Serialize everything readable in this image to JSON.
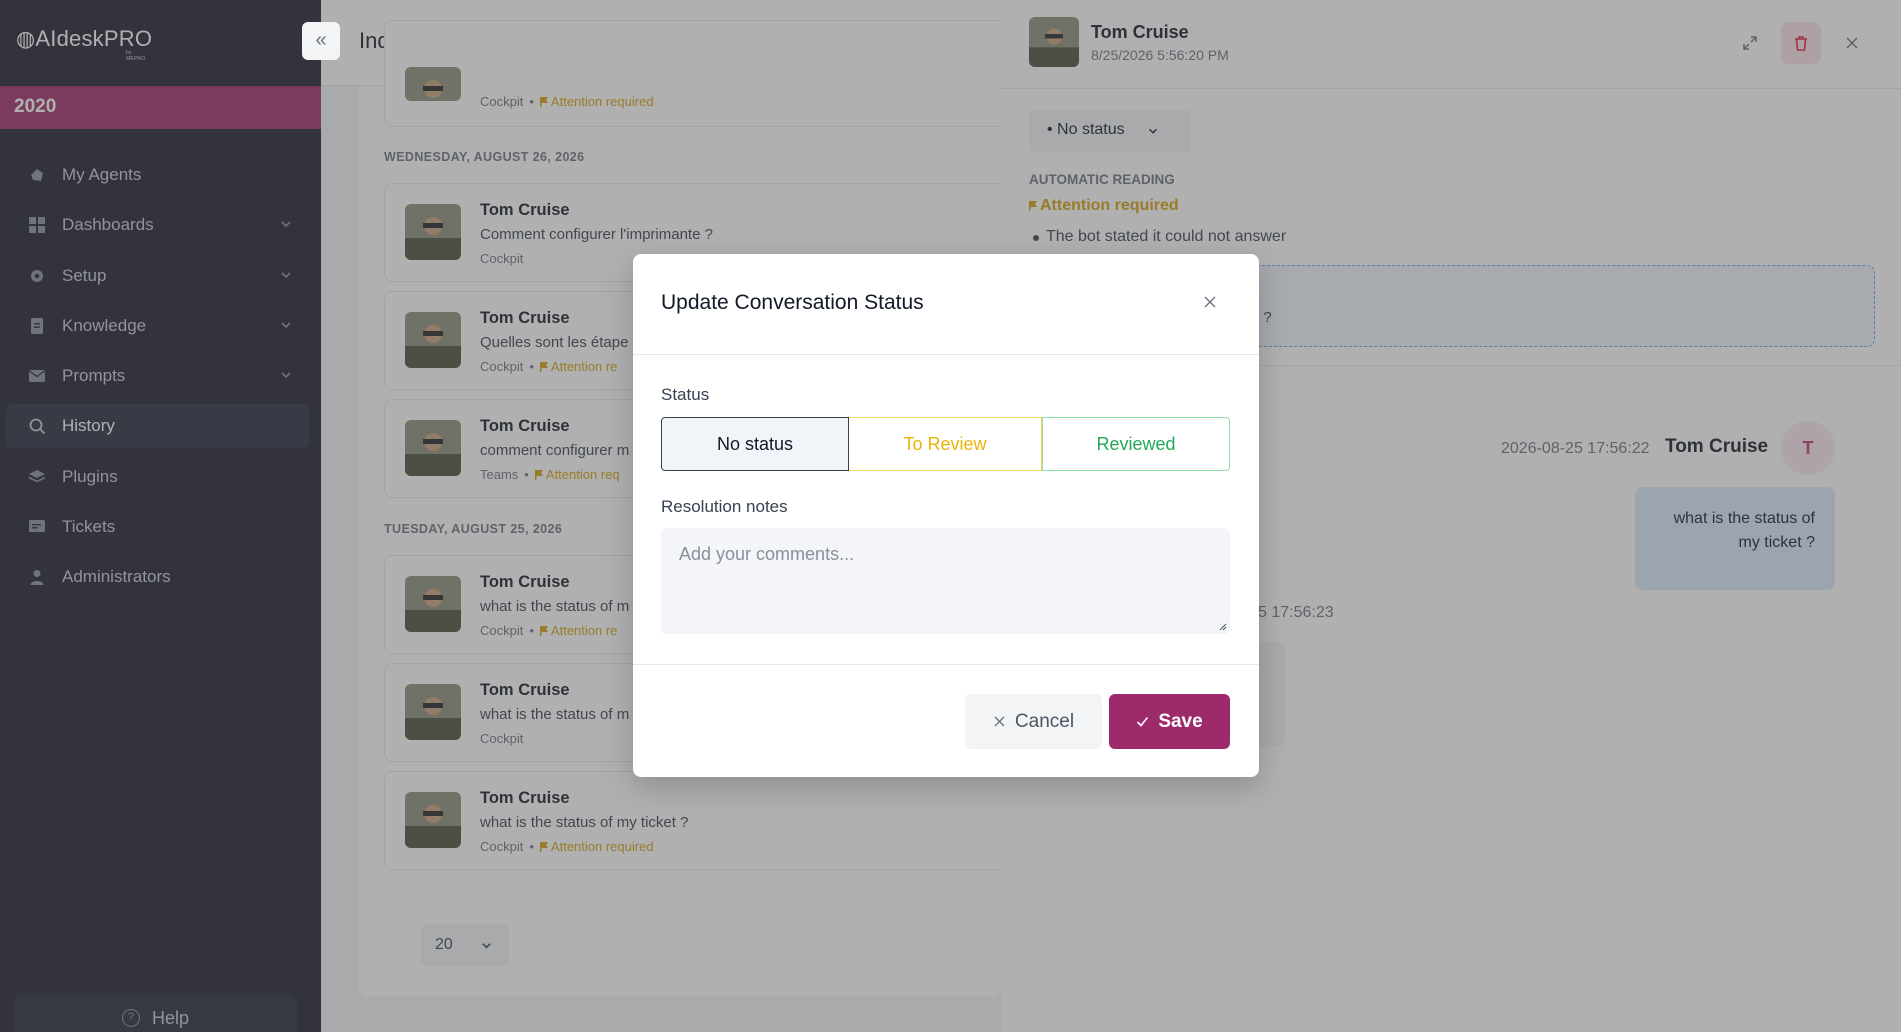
{
  "app": {
    "logo_text": "AIdeskPRO",
    "logo_sub": "by MEPRO",
    "org": "2020"
  },
  "sidebar": {
    "items": [
      {
        "label": "My Agents",
        "icon": "agents-icon",
        "expandable": false
      },
      {
        "label": "Dashboards",
        "icon": "dashboard-icon",
        "expandable": true
      },
      {
        "label": "Setup",
        "icon": "gear-icon",
        "expandable": true
      },
      {
        "label": "Knowledge",
        "icon": "document-icon",
        "expandable": true
      },
      {
        "label": "Prompts",
        "icon": "mail-icon",
        "expandable": true
      },
      {
        "label": "History",
        "icon": "search-icon",
        "expandable": false,
        "active": true
      },
      {
        "label": "Plugins",
        "icon": "layers-icon",
        "expandable": false
      },
      {
        "label": "Tickets",
        "icon": "ticket-icon",
        "expandable": false
      },
      {
        "label": "Administrators",
        "icon": "user-icon",
        "expandable": false
      }
    ],
    "help_label": "Help"
  },
  "main": {
    "title": "Index",
    "groups": [
      {
        "day": "WEDNESDAY, AUGUST 26, 2026"
      },
      {
        "day": "TUESDAY, AUGUST 25, 2026"
      }
    ],
    "conversations": [
      {
        "name": "",
        "message": "",
        "source": "Cockpit",
        "attention": "Attention required"
      },
      {
        "name": "Tom Cruise",
        "message": "Comment configurer l'imprimante ?",
        "source": "Cockpit",
        "attention": ""
      },
      {
        "name": "Tom Cruise",
        "message": "Quelles sont les étape",
        "source": "Cockpit",
        "attention": "Attention re"
      },
      {
        "name": "Tom Cruise",
        "message": "comment configurer m",
        "source": "Teams",
        "attention": "Attention req"
      },
      {
        "name": "Tom Cruise",
        "message": "what is the status of m",
        "source": "Cockpit",
        "attention": "Attention re"
      },
      {
        "name": "Tom Cruise",
        "message": "what is the status of m",
        "source": "Cockpit",
        "attention": ""
      },
      {
        "name": "Tom Cruise",
        "message": "what is the status of my ticket ?",
        "source": "Cockpit",
        "attention": "Attention required"
      }
    ],
    "page_size": "20"
  },
  "detail": {
    "name": "Tom Cruise",
    "datetime": "8/25/2026 5:56:20 PM",
    "status": "No status",
    "auto_reading_label": "AUTOMATIC READING",
    "attention": "Attention required",
    "reason": "The bot stated it could not answer",
    "question_fragment": "t ?",
    "message": {
      "time": "2026-08-25 17:56:22",
      "user": "Tom Cruise",
      "avatar_initial": "T",
      "text": "what is the status of my ticket ?"
    },
    "bot_time_fragment": "5 17:56:23"
  },
  "modal": {
    "title": "Update Conversation Status",
    "status_label": "Status",
    "options": [
      "No status",
      "To Review",
      "Reviewed"
    ],
    "selected": "No status",
    "notes_label": "Resolution notes",
    "notes_placeholder": "Add your comments...",
    "notes_value": "",
    "cancel_label": "Cancel",
    "save_label": "Save"
  },
  "colors": {
    "sidebar_bg": "#1a1c2e",
    "accent": "#9d2a6a",
    "attention": "#d4a00c",
    "to_review": "#eab308",
    "reviewed": "#22a95a"
  }
}
